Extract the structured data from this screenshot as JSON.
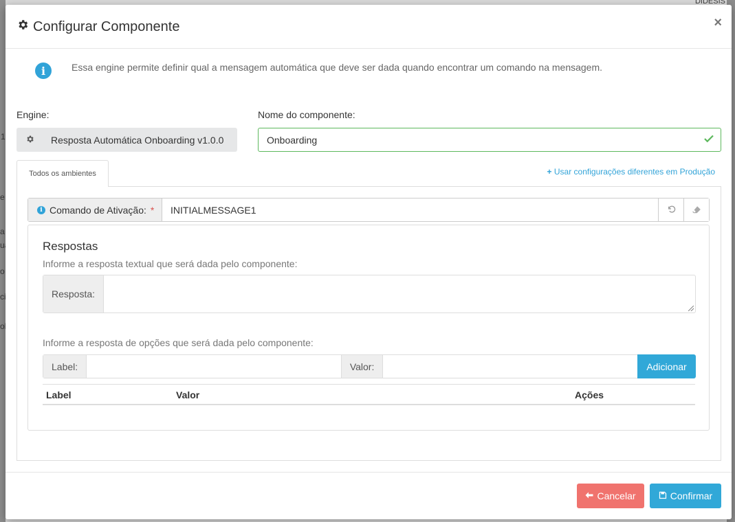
{
  "background": {
    "fragments": [
      "DIDESIS",
      "1",
      "e",
      "a",
      "ua",
      "o",
      "ci",
      "ol"
    ]
  },
  "modal": {
    "title": "Configurar Componente",
    "close_label": "×",
    "info_text": "Essa engine permite definir qual a mensagem automática que deve ser dada quando encontrar um comando na mensagem.",
    "engine_label": "Engine:",
    "engine_value": "Resposta Automática Onboarding v1.0.0",
    "name_label": "Nome do componente:",
    "name_value": "Onboarding",
    "tab_label": "Todos os ambientes",
    "prod_link": "Usar configurações diferentes em Produção",
    "command_label": "Comando de Ativação:",
    "command_required": "*",
    "command_value": "INITIALMESSAGE1",
    "responses": {
      "title": "Respostas",
      "text_hint": "Informe a resposta textual que será dada pelo componente:",
      "response_label": "Resposta:",
      "response_value": "",
      "options_hint": "Informe a resposta de opções que será dada pelo componente:",
      "label_addon": "Label:",
      "value_addon": "Valor:",
      "add_button": "Adicionar",
      "table_headers": [
        "Label",
        "Valor",
        "Ações"
      ]
    },
    "cancel_button": "Cancelar",
    "confirm_button": "Confirmar"
  },
  "colors": {
    "accent": "#31a8d8",
    "success": "#5cb85c",
    "danger": "#f0736e"
  }
}
